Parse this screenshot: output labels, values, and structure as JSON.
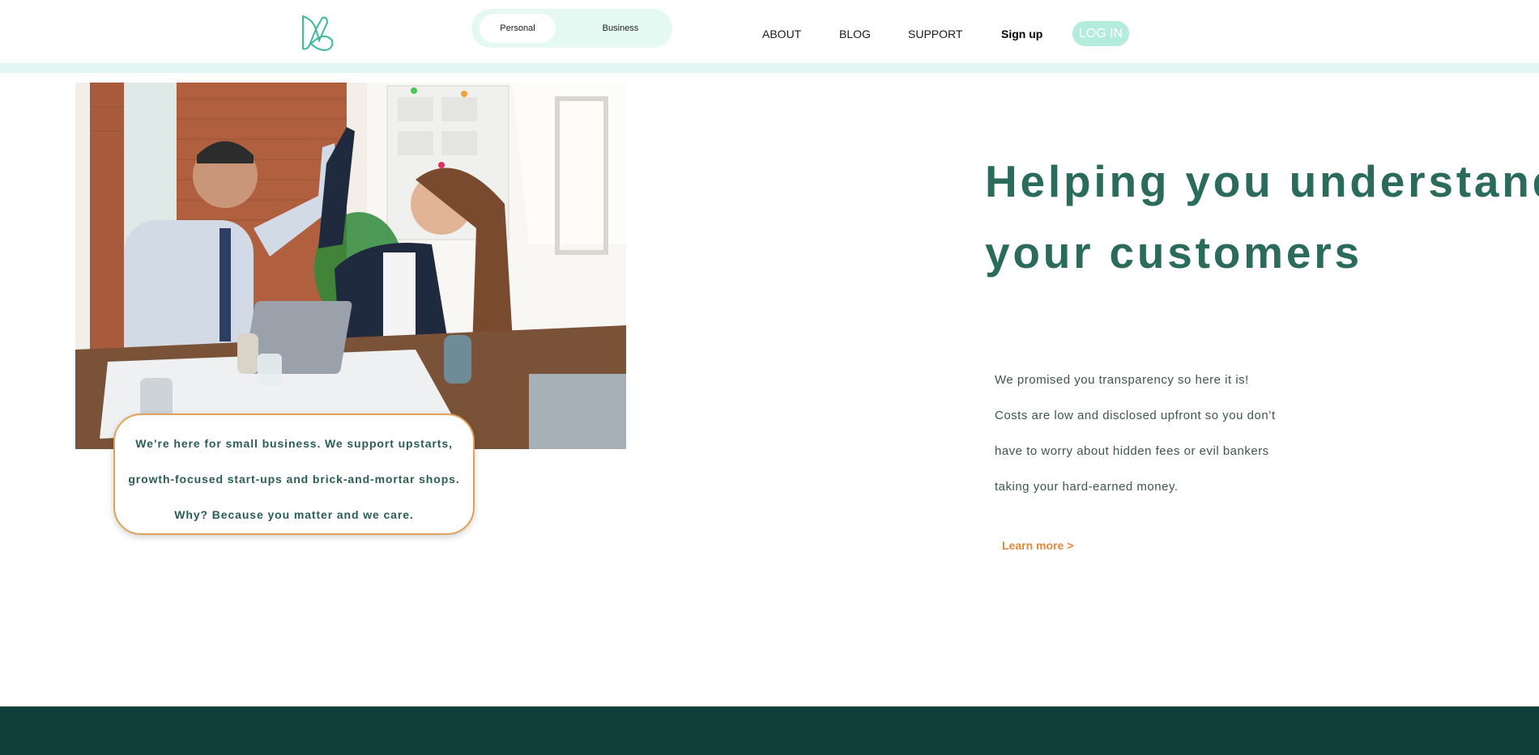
{
  "header": {
    "logo_icon": "abstract-leaf-logo-icon",
    "toggle": {
      "personal": "Personal",
      "business": "Business",
      "selected": "Personal"
    },
    "nav": {
      "about": "ABOUT",
      "blog": "BLOG",
      "support": "SUPPORT",
      "signup": "Sign up"
    },
    "login": "LOG IN"
  },
  "hero": {
    "photo_icon": "office-high-five-photo",
    "callout": [
      "We’re here for small business. We support upstarts,",
      "growth-focused start-ups and brick-and-mortar shops.",
      "Why? Because you matter and we care."
    ],
    "headline": [
      "Helping you understand",
      "your customers"
    ],
    "body": [
      "We promised you transparency so here it is!",
      "Costs are low and disclosed upfront so you don’t",
      "have to worry about hidden fees or evil bankers",
      "taking your hard-earned money."
    ],
    "learn_more": "Learn more >"
  },
  "colors": {
    "brand_dark": "#103f3b",
    "brand_green": "#2a6b5c",
    "mint": "#b4ecdb",
    "mint_light": "#e5f9f3",
    "accent_orange": "#e0893a"
  }
}
